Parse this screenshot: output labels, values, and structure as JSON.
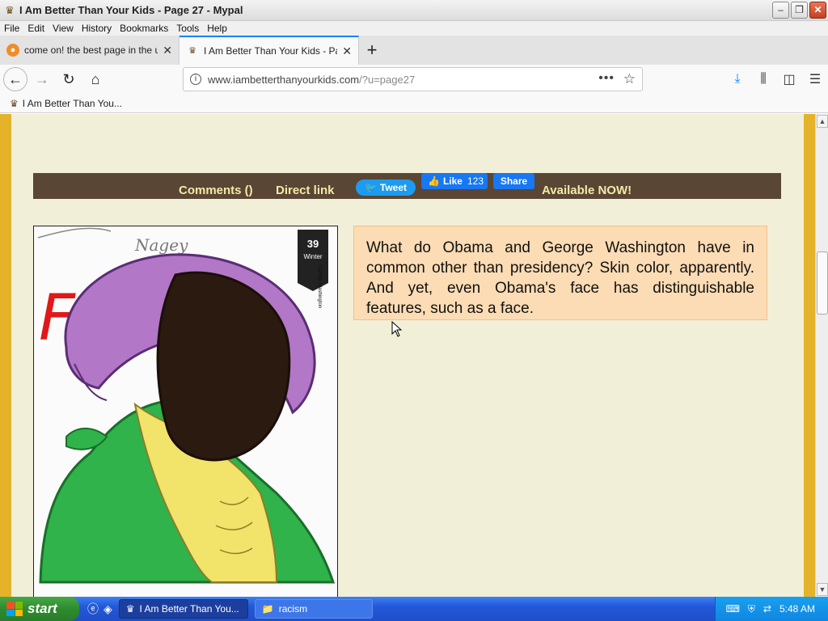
{
  "window": {
    "title": "I Am Better Than Your Kids - Page 27 - Mypal"
  },
  "menu": [
    "File",
    "Edit",
    "View",
    "History",
    "Bookmarks",
    "Tools",
    "Help"
  ],
  "tabs": [
    {
      "label": "come on! the best page in the uni",
      "icon": "reddit-icon",
      "active": false
    },
    {
      "label": "I Am Better Than Your Kids - Page",
      "icon": "crown-icon",
      "active": true
    }
  ],
  "address": {
    "host": "www.iambetterthanyourkids.com",
    "path": "/?u=page27"
  },
  "bookmarks": [
    {
      "label": "I Am Better Than You..."
    }
  ],
  "sharebar": {
    "comments": "Comments ()",
    "direct_link": "Direct link",
    "tweet": "Tweet",
    "like": "Like",
    "like_count": "123",
    "share": "Share",
    "available": "Available NOW!"
  },
  "drawing": {
    "name_scribble": "Nagey",
    "grade": "F",
    "badge_number": "39",
    "badge_word": "Winter",
    "badge_caption": "George Washington"
  },
  "caption": "What do Obama and George Washington have in common other than presidency? Skin color, apparently. And yet, even Obama's face has distinguishable features, such as a face.",
  "taskbar": {
    "start": "start",
    "items": [
      {
        "label": "I Am Better Than You...",
        "active": true
      },
      {
        "label": "racism",
        "active": false
      }
    ],
    "clock": "5:48 AM"
  },
  "colors": {
    "page_bg": "#f1efd8",
    "border_gold": "#e5b32a",
    "sharebar_bg": "#5a4634",
    "caption_bg": "#fcdcb4",
    "link_text": "#f4e9a8"
  }
}
